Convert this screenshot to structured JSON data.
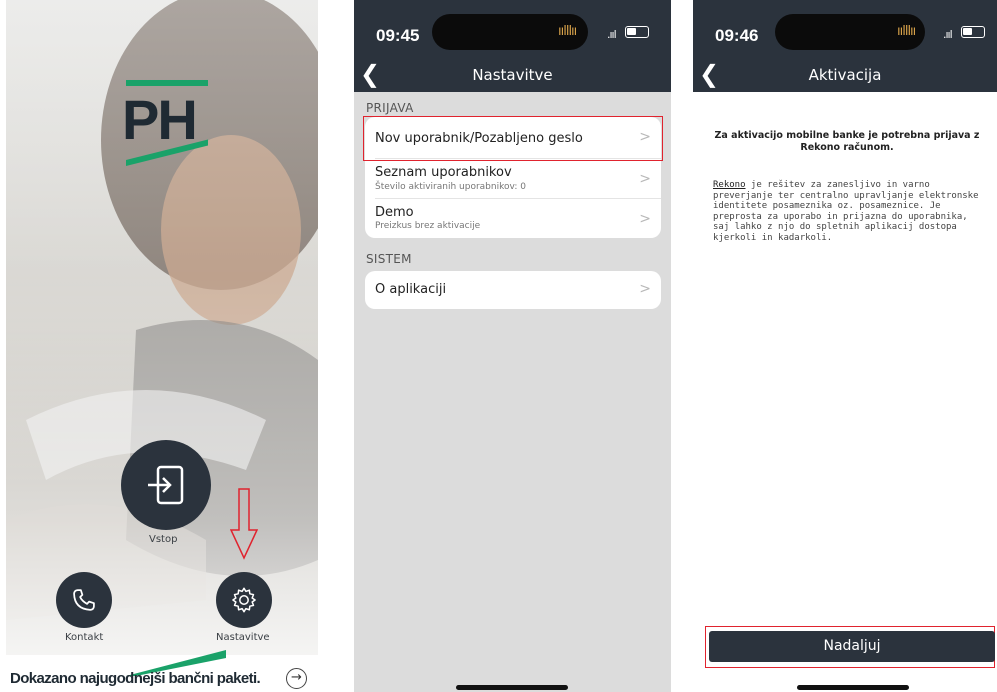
{
  "screen1": {
    "logo_text": "PH",
    "login_label": "Vstop",
    "contact_label": "Kontakt",
    "settings_label": "Nastavitve",
    "banner_text": "Dokazano najugodnejši bančni paketi.",
    "accent_color": "#1aa269",
    "icons": [
      "login-icon",
      "phone-icon",
      "gear-icon",
      "arrow-right-circle-icon"
    ]
  },
  "screen2": {
    "time": "09:45",
    "title": "Nastavitve",
    "section_login": "PRIJAVA",
    "item_new_user": "Nov uporabnik/Pozabljeno geslo",
    "item_users": "Seznam uporabnikov",
    "item_users_sub": "Število aktiviranih uporabnikov: 0",
    "item_demo": "Demo",
    "item_demo_sub": "Preizkus brez aktivacije",
    "section_system": "SISTEM",
    "item_about": "O aplikaciji"
  },
  "screen3": {
    "time": "09:46",
    "title": "Aktivacija",
    "heading": "Za aktivacijo mobilne banke je potrebna prijava z Rekono računom.",
    "body_link": "Rekono",
    "body_text": " je rešitev za zanesljivo in varno preverjanje ter centralno upravljanje elektronske identitete posameznika oz. posameznice. Je preprosta za uporabo in prijazna do uporabnika, saj lahko z njo do spletnih aplikacij dostopa kjerkoli in kadarkoli.",
    "continue_label": "Nadaljuj"
  },
  "highlight_color": "#e0232e"
}
